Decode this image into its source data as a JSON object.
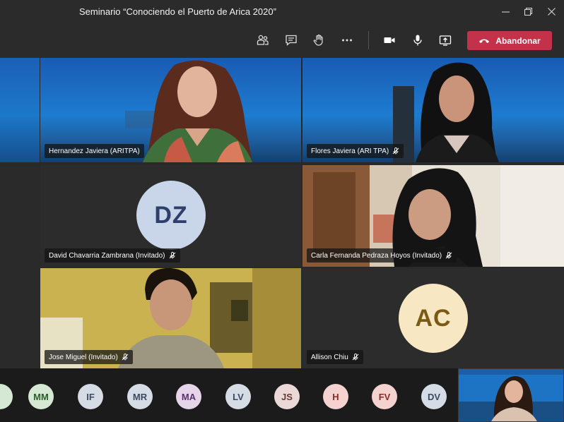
{
  "window": {
    "title": "Seminario “Conociendo el Puerto de Arica 2020”",
    "minimize_icon": "minimize-icon",
    "restore_icon": "restore-icon",
    "close_icon": "close-icon"
  },
  "toolbar": {
    "leave_label": "Abandonar",
    "icons": [
      "participants-icon",
      "chat-icon",
      "raise-hand-icon",
      "more-icon",
      "camera-icon",
      "microphone-icon",
      "share-icon",
      "hang-up-icon"
    ]
  },
  "participants": [
    {
      "name": "Hernandez Javiera (ARITPA)",
      "muted": false
    },
    {
      "name": "Flores Javiera (ARI TPA)",
      "muted": true
    },
    {
      "name": "David Chavarria Zambrana (Invitado)",
      "initials": "DZ",
      "muted": true
    },
    {
      "name": "Carla Fernanda Pedraza Hoyos (Invitado)",
      "muted": true
    },
    {
      "name": "Jose Miguel (Invitado)",
      "muted": true
    },
    {
      "name": "Allison Chiu",
      "initials": "AC",
      "muted": true
    }
  ],
  "roster": [
    {
      "initials": "MM"
    },
    {
      "initials": "IF"
    },
    {
      "initials": "MR"
    },
    {
      "initials": "MA"
    },
    {
      "initials": "LV"
    },
    {
      "initials": "JS"
    },
    {
      "initials": "H"
    },
    {
      "initials": "FV"
    },
    {
      "initials": "DV"
    }
  ],
  "colors": {
    "leave_button": "#c4314b",
    "avatar_dz": "#c9d6ea",
    "avatar_ac": "#f7e8c3"
  }
}
